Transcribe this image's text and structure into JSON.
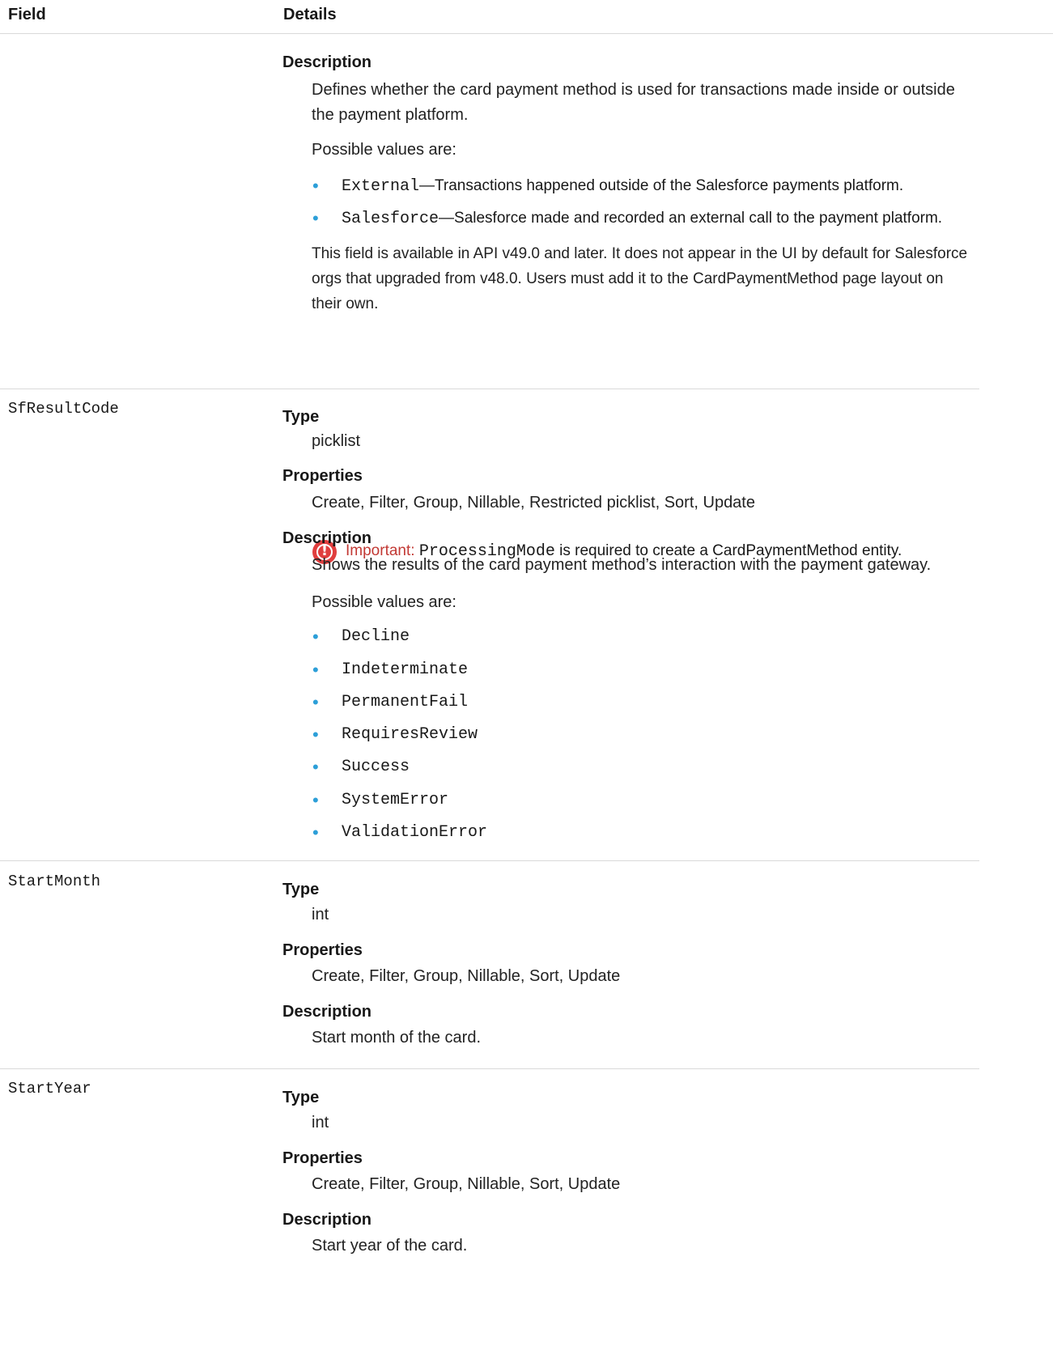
{
  "header": {
    "field_label": "Field",
    "details_label": "Details"
  },
  "processing_mode": {
    "description_label": "Description",
    "description_text": "Defines whether the card payment method is used for transactions made inside or outside the payment platform.",
    "possible_values_intro": "Possible values are:",
    "values": [
      {
        "code": "External",
        "text": "—Transactions happened outside of the Salesforce payments platform."
      },
      {
        "code": "Salesforce",
        "text": "—Salesforce made and recorded an external call to the payment platform."
      }
    ],
    "availability_note": "This field is available in API v49.0 and later. It does not appear in the UI by default for Salesforce orgs that upgraded from v48.0. Users must add it to the CardPaymentMethod page layout on their own.",
    "important": {
      "icon": "exclamation-circle-icon",
      "label": "Important",
      "colon": ":",
      "code": "ProcessingMode",
      "text": " is required to create a CardPaymentMethod entity."
    }
  },
  "sf_result_code": {
    "field_name": "SfResultCode",
    "type_label": "Type",
    "type_value": "picklist",
    "properties_label": "Properties",
    "properties_value": "Create, Filter, Group, Nillable, Restricted picklist, Sort, Update",
    "description_label": "Description",
    "description_text": "Shows the results of the card payment method’s interaction with the payment gateway.",
    "possible_values_intro": "Possible values are:",
    "values": [
      "Decline",
      "Indeterminate",
      "PermanentFail",
      "RequiresReview",
      "Success",
      "SystemError",
      "ValidationError"
    ]
  },
  "start_month": {
    "field_name": "StartMonth",
    "type_label": "Type",
    "type_value": "int",
    "properties_label": "Properties",
    "properties_value": "Create, Filter, Group, Nillable, Sort, Update",
    "description_label": "Description",
    "description_text": "Start month of the card."
  },
  "start_year": {
    "field_name": "StartYear",
    "type_label": "Type",
    "type_value": "int",
    "properties_label": "Properties",
    "properties_value": "Create, Filter, Group, Nillable, Sort, Update",
    "description_label": "Description",
    "description_text": "Start year of the card."
  },
  "colors": {
    "bullet": "#2d9fd8",
    "important_icon": "#e03e3e",
    "important_label": "#c23934",
    "divider": "#d9d9d9"
  }
}
